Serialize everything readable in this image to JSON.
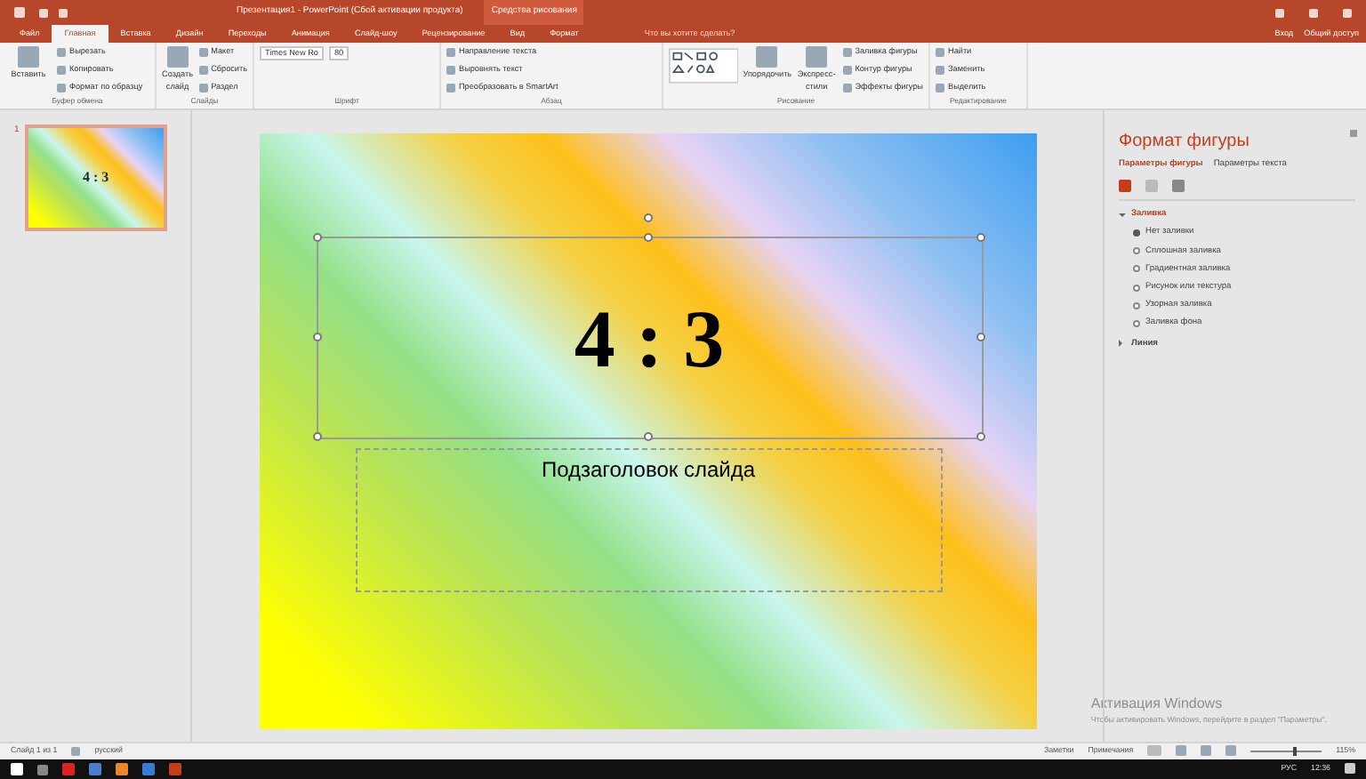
{
  "window": {
    "title": "Презентация1 - PowerPoint (Сбой активации продукта)",
    "context_label": "Средства рисования",
    "sign_in": "Вход",
    "share": "Общий доступ"
  },
  "tabs": [
    {
      "label": "Файл",
      "selected": false
    },
    {
      "label": "Главная",
      "selected": true
    },
    {
      "label": "Вставка",
      "selected": false
    },
    {
      "label": "Дизайн",
      "selected": false
    },
    {
      "label": "Переходы",
      "selected": false
    },
    {
      "label": "Анимация",
      "selected": false
    },
    {
      "label": "Слайд-шоу",
      "selected": false
    },
    {
      "label": "Рецензирование",
      "selected": false
    },
    {
      "label": "Вид",
      "selected": false
    },
    {
      "label": "Формат",
      "selected": false
    }
  ],
  "tell_me": "Что вы хотите сделать?",
  "ribbon": [
    {
      "label": "Буфер обмена",
      "items": [
        {
          "kind": "large",
          "text": "Вставить"
        },
        {
          "kind": "small",
          "text": "Вырезать"
        },
        {
          "kind": "small",
          "text": "Копировать"
        },
        {
          "kind": "small",
          "text": "Формат по образцу"
        }
      ]
    },
    {
      "label": "Слайды",
      "items": [
        {
          "kind": "large",
          "text": "Создать слайд"
        },
        {
          "kind": "small",
          "text": "Макет"
        },
        {
          "kind": "small",
          "text": "Сбросить"
        },
        {
          "kind": "small",
          "text": "Раздел"
        }
      ]
    },
    {
      "label": "Шрифт",
      "items": [
        {
          "kind": "field",
          "text": "Times New Ro"
        },
        {
          "kind": "field",
          "text": "80"
        }
      ]
    },
    {
      "label": "Абзац",
      "items": [
        {
          "kind": "small",
          "text": "Направление текста"
        },
        {
          "kind": "small",
          "text": "Выровнять текст"
        },
        {
          "kind": "small",
          "text": "Преобразовать в SmartArt"
        }
      ]
    },
    {
      "label": "Рисование",
      "items": [
        {
          "kind": "shapes"
        },
        {
          "kind": "large",
          "text": "Упорядочить"
        },
        {
          "kind": "large",
          "text": "Экспресс-стили"
        },
        {
          "kind": "small",
          "text": "Заливка фигуры"
        },
        {
          "kind": "small",
          "text": "Контур фигуры"
        },
        {
          "kind": "small",
          "text": "Эффекты фигуры"
        }
      ]
    },
    {
      "label": "Редактирование",
      "items": [
        {
          "kind": "small",
          "text": "Найти"
        },
        {
          "kind": "small",
          "text": "Заменить"
        },
        {
          "kind": "small",
          "text": "Выделить"
        }
      ]
    }
  ],
  "thumbnails": [
    {
      "number": "1",
      "title": "4 : 3",
      "selected": true
    }
  ],
  "slide": {
    "title": "4 : 3",
    "subtitle": "Подзаголовок слайда",
    "title_selected": true
  },
  "format_pane": {
    "title": "Формат фигуры",
    "tabs": [
      {
        "label": "Параметры фигуры",
        "selected": true
      },
      {
        "label": "Параметры текста",
        "selected": false
      }
    ],
    "sections": [
      {
        "label": "Заливка",
        "expanded": true,
        "options": [
          {
            "label": "Нет заливки",
            "checked": true
          },
          {
            "label": "Сплошная заливка",
            "checked": false
          },
          {
            "label": "Градиентная заливка",
            "checked": false
          },
          {
            "label": "Рисунок или текстура",
            "checked": false
          },
          {
            "label": "Узорная заливка",
            "checked": false
          },
          {
            "label": "Заливка фона",
            "checked": false
          }
        ]
      },
      {
        "label": "Линия",
        "expanded": false
      }
    ]
  },
  "activation": {
    "title": "Активация Windows",
    "text": "Чтобы активировать Windows, перейдите в раздел \"Параметры\"."
  },
  "status_bar": {
    "slide": "Слайд 1 из 1",
    "language": "русский",
    "notes": "Заметки",
    "comments": "Примечания",
    "zoom": "115%",
    "level": 0.6
  },
  "taskbar": {
    "language": "РУС",
    "time": "12:36"
  }
}
